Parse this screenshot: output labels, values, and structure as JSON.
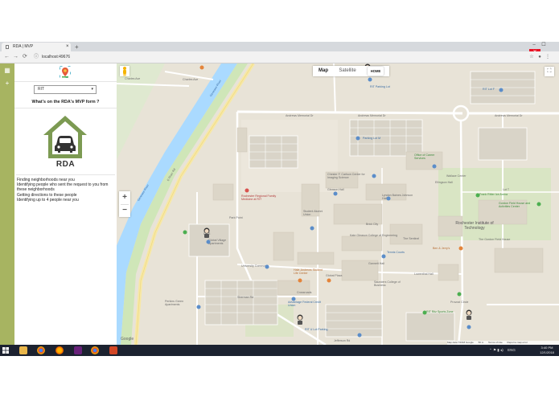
{
  "browser": {
    "tab_title": "RDA | MVP",
    "tab_close": "×",
    "new_tab": "+",
    "window_controls": {
      "minimize": "–",
      "maximize": "☐",
      "close": "✕"
    },
    "nav": {
      "back": "←",
      "forward": "→",
      "reload": "⟳"
    },
    "url": "localhost:49676",
    "toolbar_icons": {
      "bookmark": "☆",
      "account": "●",
      "menu": "⋮"
    }
  },
  "rail": {
    "items": [
      {
        "icon": "grid-icon",
        "glyph": "▦"
      },
      {
        "icon": "plus-icon",
        "glyph": "+"
      }
    ]
  },
  "panel": {
    "location_select": "RIT",
    "caret": "▾",
    "form_title": "What's on the RDA's MVP form ?",
    "brand": "RDA",
    "features": [
      "Finding neighborhoods near you",
      "Identifying people who sent the request to you from these neighborhoods",
      "Getting directions to these people",
      "Identifying up to 4 people near you"
    ]
  },
  "map": {
    "controls": {
      "map": "Map",
      "satellite": "Satellite",
      "home": "HOME",
      "zoom_in": "+",
      "zoom_out": "−",
      "fullscreen": "⛶"
    },
    "watermark": "Google",
    "attribution": [
      "Map data ©2018 Google",
      "50 m",
      "Terms of Use",
      "Report a map error"
    ],
    "labels": {
      "charles_ave": "Charles Ave",
      "charles_ave2": "Charles Ave",
      "andrews_memorial": "Andrews Memorial Dr",
      "andrews_memorial2": "Andrews Memorial Dr",
      "andrews_memorial3": "Andrews Memorial Dr",
      "genesee_river": "Genesee River",
      "genesee_river2": "Genesee River",
      "east_river_rd": "E River Rd",
      "lot_parking": "RIT Parking Lot",
      "parking_lot_m": "Parking Lot M",
      "carlson_center": "Chester F. Carlson Center for Imaging Science",
      "gleason_hall": "Gleason Hall",
      "rit_main": "Rochester Institute of Technology",
      "rochester_regional": "Rochester Regional Family Medicine at RIT",
      "kate_gleason": "Kate Gleason College of Engineering",
      "sentinel": "The Sentinel",
      "ben_jerrys": "Ben & Jerry's",
      "frank_ritter": "Frank Ritter Ice Arena",
      "gordon_field_house": "Gordon Field House and Activities Center",
      "global_village": "Global Village Apartments",
      "university_commons": "University Commons",
      "perkins_green": "Perkins Green Apartments",
      "tennis": "Tennis Courts",
      "lyndon_baines": "Lyndon Baines Johnson Hall",
      "student_alumni": "Student Alumni Union",
      "brick_city": "Brick City",
      "gannett": "Gannett Hall",
      "global_plaza": "Global Plaza",
      "sherman": "Sherman Rd",
      "sauders": "Saunders College of Business",
      "office_of_career": "Office of Career Services",
      "ritz": "RIT Ritz Sports Zone",
      "ellingson": "Ellingson Hall",
      "lot_t": "Lot T",
      "lot_f": "RIT Lot F",
      "ripple_center": "Wallace Center",
      "zaft": "The Gordon Field House",
      "u_lot": "RIT U Lot Parking",
      "jefferson_rd": "Jefferson Rd",
      "park_point": "Park Point",
      "advantage": "Advantage Federal Credit Union",
      "crossroads": "Crossroads",
      "lot_s": "Lot S",
      "pc": "Provost Circle",
      "cgm": "Lowenthal Hall",
      "hbj": "Hale-Andrews Student Life Center"
    }
  },
  "taskbar": {
    "icons": [
      "windows-start-icon",
      "file-explorer-icon",
      "chrome-icon",
      "firefox-icon",
      "visual-studio-icon",
      "chrome-icon",
      "powerpoint-icon"
    ],
    "tray": "ENG",
    "time": "3:40 PM",
    "date": "12/1/2018"
  },
  "colors": {
    "rail": "#a7b461",
    "map_bg": "#e8e3d7",
    "river": "#aadaff",
    "road": "#ffffff",
    "road_major": "#f7e8a6",
    "green": "#cfe6b8",
    "building": "#dcd6c8",
    "taskbar": "#1c2230"
  }
}
